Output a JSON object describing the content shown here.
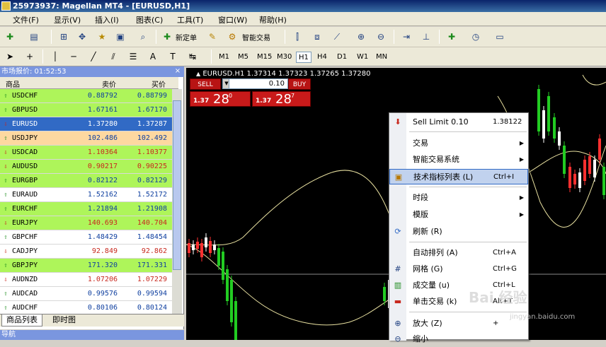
{
  "window": {
    "title": "25973937: Magellan MT4 - [EURUSD,H1]"
  },
  "menu": [
    "文件(F)",
    "显示(V)",
    "插入(I)",
    "图表(C)",
    "工具(T)",
    "窗口(W)",
    "帮助(H)"
  ],
  "toolbar": {
    "new_order": "新定单",
    "expert": "智能交易"
  },
  "timeframes": [
    "M1",
    "M5",
    "M15",
    "M30",
    "H1",
    "H4",
    "D1",
    "W1",
    "MN"
  ],
  "timeframe_active": "H1",
  "market_watch": {
    "title": "市场报价: 01:52:53",
    "close": "×",
    "headers": {
      "symbol": "商品",
      "bid": "卖价",
      "ask": "买价"
    },
    "rows": [
      {
        "symbol": "USDCHF",
        "bid": "0.88792",
        "ask": "0.88799",
        "dir": "up",
        "bg": "g"
      },
      {
        "symbol": "GBPUSD",
        "bid": "1.67161",
        "ask": "1.67170",
        "dir": "up",
        "bg": "g"
      },
      {
        "symbol": "EURUSD",
        "bid": "1.37280",
        "ask": "1.37287",
        "dir": "dn",
        "bg": "s"
      },
      {
        "symbol": "USDJPY",
        "bid": "102.486",
        "ask": "102.492",
        "dir": "up",
        "bg": "o"
      },
      {
        "symbol": "USDCAD",
        "bid": "1.10364",
        "ask": "1.10377",
        "dir": "dn",
        "bg": "g"
      },
      {
        "symbol": "AUDUSD",
        "bid": "0.90217",
        "ask": "0.90225",
        "dir": "dn",
        "bg": "g"
      },
      {
        "symbol": "EURGBP",
        "bid": "0.82122",
        "ask": "0.82129",
        "dir": "up",
        "bg": "g"
      },
      {
        "symbol": "EURAUD",
        "bid": "1.52162",
        "ask": "1.52172",
        "dir": "up",
        "bg": "w"
      },
      {
        "symbol": "EURCHF",
        "bid": "1.21894",
        "ask": "1.21908",
        "dir": "up",
        "bg": "g"
      },
      {
        "symbol": "EURJPY",
        "bid": "140.693",
        "ask": "140.704",
        "dir": "dn",
        "bg": "g"
      },
      {
        "symbol": "GBPCHF",
        "bid": "1.48429",
        "ask": "1.48454",
        "dir": "up",
        "bg": "w"
      },
      {
        "symbol": "CADJPY",
        "bid": "92.849",
        "ask": "92.862",
        "dir": "dn",
        "bg": "w"
      },
      {
        "symbol": "GBPJPY",
        "bid": "171.320",
        "ask": "171.331",
        "dir": "up",
        "bg": "g"
      },
      {
        "symbol": "AUDNZD",
        "bid": "1.07206",
        "ask": "1.07229",
        "dir": "dn",
        "bg": "w"
      },
      {
        "symbol": "AUDCAD",
        "bid": "0.99576",
        "ask": "0.99594",
        "dir": "up",
        "bg": "w"
      },
      {
        "symbol": "AUDCHF",
        "bid": "0.80106",
        "ask": "0.80124",
        "dir": "up",
        "bg": "w"
      }
    ],
    "tabs": [
      "商品列表",
      "即时图"
    ]
  },
  "navigator": {
    "title": "导航"
  },
  "chart": {
    "info": "EURUSD.H1  1.37314 1.37323 1.37265 1.37280",
    "sell_label": "SELL",
    "buy_label": "BUY",
    "volume": "0.10",
    "sell_price_small": "1.37",
    "sell_price_big": "28",
    "sell_price_sup": "0",
    "buy_price_small": "1.37",
    "buy_price_big": "28",
    "buy_price_sup": "7"
  },
  "context_menu": {
    "items": [
      {
        "label": "Sell Limit 0.10",
        "shortcut": "1.38122",
        "icon": "arrow-down-icon"
      },
      {
        "label": "交易",
        "shortcut": "",
        "submenu": true
      },
      {
        "label": "智能交易系统",
        "shortcut": "",
        "submenu": true
      },
      {
        "label": "技术指标列表 (L)",
        "shortcut": "Ctrl+I",
        "highlighted": true
      },
      {
        "label": "时段",
        "shortcut": "",
        "submenu": true
      },
      {
        "label": "模版",
        "shortcut": "",
        "submenu": true
      },
      {
        "label": "刷新 (R)",
        "shortcut": ""
      },
      {
        "label": "自动排列 (A)",
        "shortcut": "Ctrl+A"
      },
      {
        "label": "网格 (G)",
        "shortcut": "Ctrl+G"
      },
      {
        "label": "成交量 (u)",
        "shortcut": "Ctrl+L"
      },
      {
        "label": "单击交易 (k)",
        "shortcut": "Alt+T"
      },
      {
        "label": "放大 (Z)",
        "shortcut": "+"
      },
      {
        "label": "缩小",
        "shortcut": ""
      }
    ]
  },
  "watermark": {
    "brand": "Bai 经验",
    "url": "jingyan.baidu.com"
  },
  "colors": {
    "accent": "#316ac5",
    "up": "#1c8a1c",
    "down": "#c8281e",
    "buy_sell": "#c81a1a"
  }
}
